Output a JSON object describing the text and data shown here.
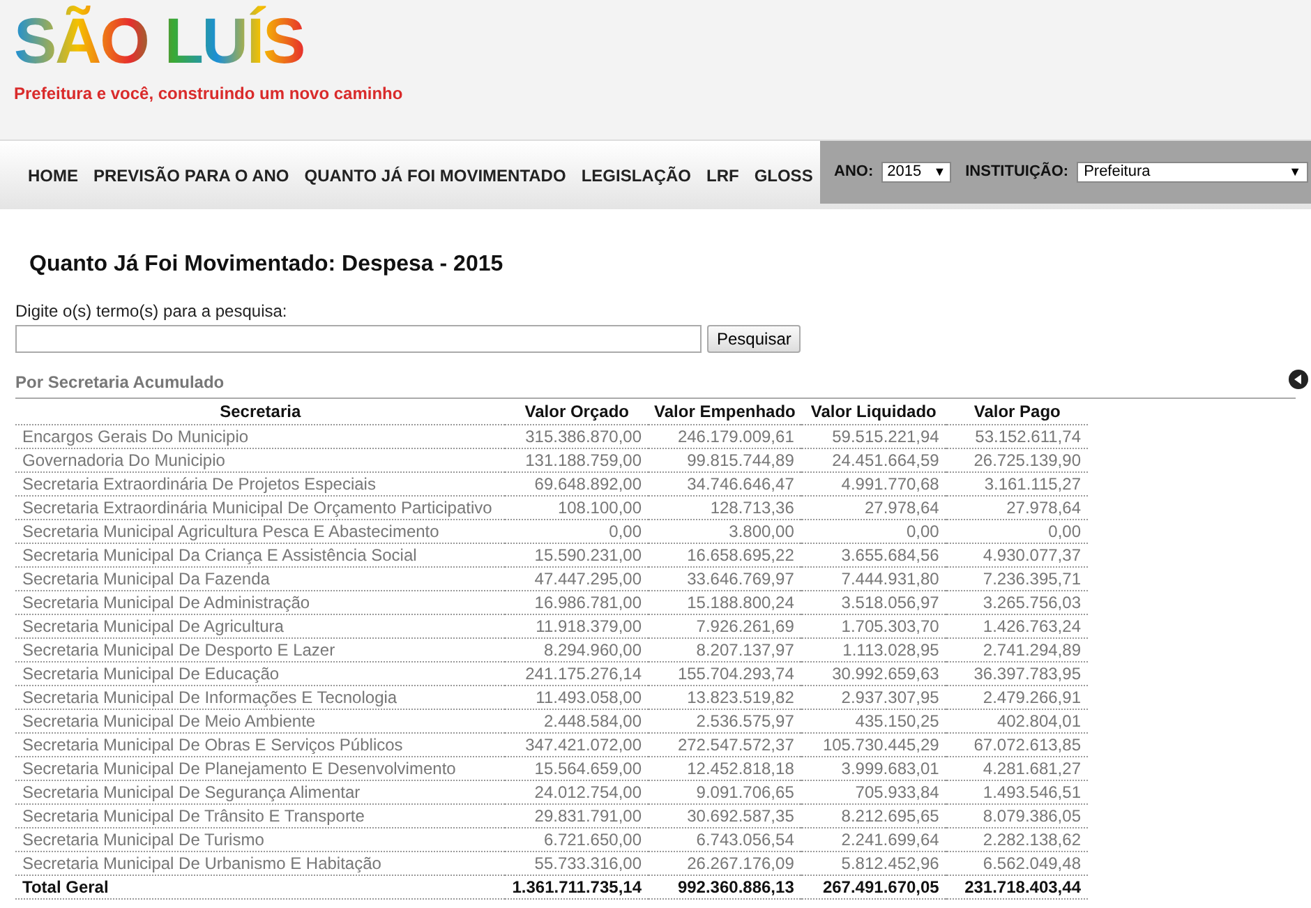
{
  "header": {
    "logo": "SÃO LUÍS",
    "tagline": "Prefeitura e você, construindo um novo caminho"
  },
  "nav": {
    "items": [
      "HOME",
      "PREVISÃO PARA O ANO",
      "QUANTO JÁ FOI MOVIMENTADO",
      "LEGISLAÇÃO",
      "LRF",
      "GLOSS"
    ]
  },
  "filters": {
    "year_label": "ANO:",
    "year": "2015",
    "year_caret": "▼",
    "institution_label": "INSTITUIÇÃO:",
    "institution": "Prefeitura",
    "institution_caret": "▼"
  },
  "title": "Quanto Já Foi Movimentado: Despesa - 2015",
  "search": {
    "label": "Digite o(s) termo(s) para a pesquisa:",
    "button": "Pesquisar"
  },
  "section": {
    "title": "Por Secretaria Acumulado"
  },
  "table": {
    "columns": [
      "Secretaria",
      "Valor Orçado",
      "Valor Empenhado",
      "Valor Liquidado",
      "Valor Pago"
    ],
    "rows": [
      [
        "Encargos Gerais Do Municipio",
        "315.386.870,00",
        "246.179.009,61",
        "59.515.221,94",
        "53.152.611,74"
      ],
      [
        "Governadoria Do Municipio",
        "131.188.759,00",
        "99.815.744,89",
        "24.451.664,59",
        "26.725.139,90"
      ],
      [
        "Secretaria Extraordinária De Projetos Especiais",
        "69.648.892,00",
        "34.746.646,47",
        "4.991.770,68",
        "3.161.115,27"
      ],
      [
        "Secretaria Extraordinária Municipal De Orçamento Participativo",
        "108.100,00",
        "128.713,36",
        "27.978,64",
        "27.978,64"
      ],
      [
        "Secretaria Municipal Agricultura Pesca E Abastecimento",
        "0,00",
        "3.800,00",
        "0,00",
        "0,00"
      ],
      [
        "Secretaria Municipal Da Criança E Assistência Social",
        "15.590.231,00",
        "16.658.695,22",
        "3.655.684,56",
        "4.930.077,37"
      ],
      [
        "Secretaria Municipal Da Fazenda",
        "47.447.295,00",
        "33.646.769,97",
        "7.444.931,80",
        "7.236.395,71"
      ],
      [
        "Secretaria Municipal De Administração",
        "16.986.781,00",
        "15.188.800,24",
        "3.518.056,97",
        "3.265.756,03"
      ],
      [
        "Secretaria Municipal De Agricultura",
        "11.918.379,00",
        "7.926.261,69",
        "1.705.303,70",
        "1.426.763,24"
      ],
      [
        "Secretaria Municipal De Desporto E Lazer",
        "8.294.960,00",
        "8.207.137,97",
        "1.113.028,95",
        "2.741.294,89"
      ],
      [
        "Secretaria Municipal De Educação",
        "241.175.276,14",
        "155.704.293,74",
        "30.992.659,63",
        "36.397.783,95"
      ],
      [
        "Secretaria Municipal De Informações E Tecnologia",
        "11.493.058,00",
        "13.823.519,82",
        "2.937.307,95",
        "2.479.266,91"
      ],
      [
        "Secretaria Municipal De Meio Ambiente",
        "2.448.584,00",
        "2.536.575,97",
        "435.150,25",
        "402.804,01"
      ],
      [
        "Secretaria Municipal De Obras E Serviços Públicos",
        "347.421.072,00",
        "272.547.572,37",
        "105.730.445,29",
        "67.072.613,85"
      ],
      [
        "Secretaria Municipal De Planejamento E Desenvolvimento",
        "15.564.659,00",
        "12.452.818,18",
        "3.999.683,01",
        "4.281.681,27"
      ],
      [
        "Secretaria Municipal De Segurança Alimentar",
        "24.012.754,00",
        "9.091.706,65",
        "705.933,84",
        "1.493.546,51"
      ],
      [
        "Secretaria Municipal De Trânsito E Transporte",
        "29.831.791,00",
        "30.692.587,35",
        "8.212.695,65",
        "8.079.386,05"
      ],
      [
        "Secretaria Municipal De Turismo",
        "6.721.650,00",
        "6.743.056,54",
        "2.241.699,64",
        "2.282.138,62"
      ],
      [
        "Secretaria Municipal De Urbanismo E Habitação",
        "55.733.316,00",
        "26.267.176,09",
        "5.812.452,96",
        "6.562.049,48"
      ]
    ],
    "total": [
      "Total Geral",
      "1.361.711.735,14",
      "992.360.886,13",
      "267.491.670,05",
      "231.718.403,44"
    ]
  }
}
